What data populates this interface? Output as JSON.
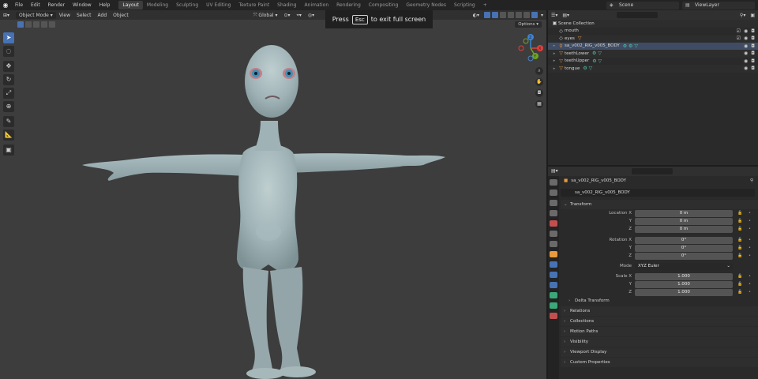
{
  "menu": [
    "File",
    "Edit",
    "Render",
    "Window",
    "Help"
  ],
  "workspaces": [
    "Layout",
    "Modeling",
    "Sculpting",
    "UV Editing",
    "Texture Paint",
    "Shading",
    "Animation",
    "Rendering",
    "Compositing",
    "Geometry Nodes",
    "Scripting"
  ],
  "active_workspace": "Layout",
  "add_workspace": "+",
  "scene_name": "Scene",
  "view_layer": "ViewLayer",
  "viewport": {
    "mode": "Object Mode",
    "menus": [
      "View",
      "Select",
      "Add",
      "Object"
    ],
    "transform_orientation": "Global",
    "options_label": "Options"
  },
  "toast": {
    "prefix": "Press",
    "key": "Esc",
    "suffix": "to exit full screen"
  },
  "gizmo": {
    "x": "X",
    "y": "Y",
    "z": "Z"
  },
  "outliner": {
    "root": "Scene Collection",
    "items": [
      {
        "name": "mouth",
        "indent": 1
      },
      {
        "name": "eyes",
        "indent": 1
      },
      {
        "name": "sa_v002_RIG_v005_BODY",
        "indent": 1
      },
      {
        "name": "teethLower",
        "indent": 1
      },
      {
        "name": "teethUpper",
        "indent": 1
      },
      {
        "name": "tongue",
        "indent": 1
      }
    ]
  },
  "properties": {
    "object_title": "sa_v002_RIG_v005_BODY",
    "object_name": "sa_v002_RIG_v005_BODY",
    "transform_label": "Transform",
    "location": {
      "label": "Location X",
      "x": "0 m",
      "y": "0 m",
      "z": "0 m"
    },
    "rotation": {
      "label": "Rotation X",
      "x": "0°",
      "y": "0°",
      "z": "0°"
    },
    "mode": {
      "label": "Mode",
      "value": "XYZ Euler"
    },
    "scale": {
      "label": "Scale X",
      "x": "1.000",
      "y": "1.000",
      "z": "1.000"
    },
    "axis_y": "Y",
    "axis_z": "Z",
    "delta_transform": "Delta Transform",
    "panels": [
      "Relations",
      "Collections",
      "Motion Paths",
      "Visibility",
      "Viewport Display",
      "Custom Properties"
    ]
  },
  "colors": {
    "accent": "#4772b3",
    "viewport_bg": "#3d3d3d",
    "axis_x": "#e0403f",
    "axis_y": "#6fa421",
    "axis_z": "#3d83d6"
  }
}
